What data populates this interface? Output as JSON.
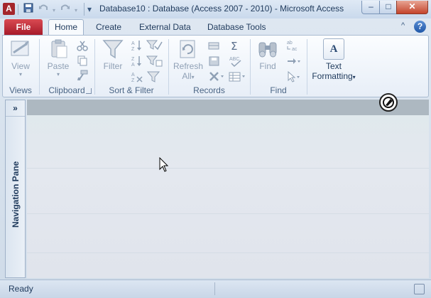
{
  "app": {
    "icon_letter": "A",
    "title": "Database10 : Database (Access 2007 - 2010)  -  Microsoft Access",
    "window_controls": {
      "minimize": "–",
      "maximize": "□",
      "close": "✕"
    }
  },
  "quick_access": {
    "save_icon": "save-icon",
    "undo_icon": "undo-icon",
    "redo_icon": "redo-icon",
    "customize_glyph": "▾"
  },
  "tabs": [
    {
      "label": "File"
    },
    {
      "label": "Home"
    },
    {
      "label": "Create"
    },
    {
      "label": "External Data"
    },
    {
      "label": "Database Tools"
    }
  ],
  "help": {
    "glyph": "?",
    "minimize_glyph": "^"
  },
  "ribbon": {
    "groups": {
      "views": {
        "label": "Views",
        "view_label": "View"
      },
      "clipboard": {
        "label": "Clipboard",
        "paste_label": "Paste"
      },
      "sort_filter": {
        "label": "Sort & Filter",
        "filter_label": "Filter"
      },
      "records": {
        "label": "Records",
        "refresh_label_1": "Refresh",
        "refresh_label_2": "All"
      },
      "find": {
        "label": "Find",
        "find_label": "Find"
      },
      "text_formatting": {
        "label_1": "Text",
        "label_2": "Formatting",
        "icon_letter": "A"
      }
    }
  },
  "navigation_pane": {
    "toggle": "»",
    "label": "Navigation Pane"
  },
  "status_bar": {
    "text": "Ready"
  },
  "colors": {
    "file_tab": "#c4293a",
    "accent": "#1e395b",
    "disabled_icon": "#8fa0b5"
  }
}
